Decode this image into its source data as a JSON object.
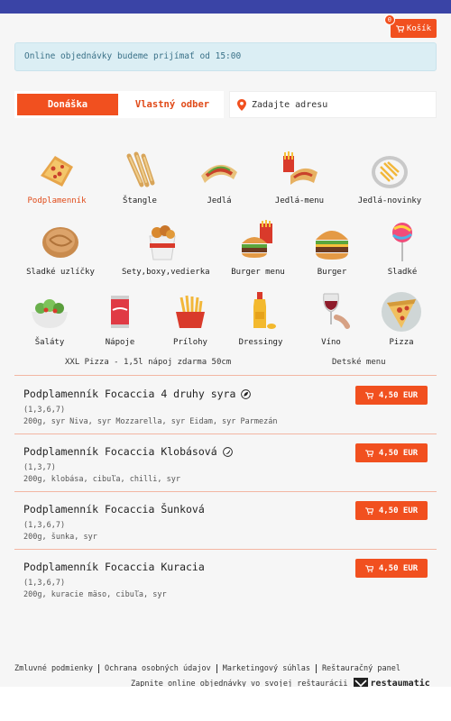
{
  "header": {
    "cart_label": "Košík",
    "cart_count": "0"
  },
  "notice": "Online objednávky budeme prijímať od 15:00",
  "modes": {
    "delivery": "Donáška",
    "pickup": "Vlastný odber"
  },
  "address": {
    "placeholder": "Zadajte adresu"
  },
  "categories": [
    {
      "label": "Podplamenník",
      "icon": "flatbread-icon",
      "active": true
    },
    {
      "label": "Štangle",
      "icon": "breadsticks-icon"
    },
    {
      "label": "Jedlá",
      "icon": "wrap-icon"
    },
    {
      "label": "Jedlá-menu",
      "icon": "meal-menu-icon"
    },
    {
      "label": "Jedlá-novinky",
      "icon": "fries-plate-icon"
    },
    {
      "label": "Sladké uzlíčky",
      "icon": "knot-pastry-icon"
    },
    {
      "label": "Sety,boxy,vedierka",
      "icon": "bucket-icon"
    },
    {
      "label": "Burger menu",
      "icon": "burger-menu-icon"
    },
    {
      "label": "Burger",
      "icon": "burger-icon"
    },
    {
      "label": "Sladké",
      "icon": "lollipop-icon"
    },
    {
      "label": "Šaláty",
      "icon": "salad-icon"
    },
    {
      "label": "Nápoje",
      "icon": "cola-can-icon"
    },
    {
      "label": "Prílohy",
      "icon": "fries-icon"
    },
    {
      "label": "Dressingy",
      "icon": "dressing-bottle-icon"
    },
    {
      "label": "Víno",
      "icon": "wine-glass-icon"
    },
    {
      "label": "Pizza",
      "icon": "pizza-slice-icon"
    }
  ],
  "subcategories": [
    "XXL Pizza - 1,5l nápoj zdarma 50cm",
    "Detské menu"
  ],
  "items": [
    {
      "name": "Podplamenník Focaccia 4 druhy syra",
      "allergens": "(1,3,6,7)",
      "desc": "200g, syr Niva, syr Mozzarella, syr Eidam, syr Parmezán",
      "price": "4,50 EUR",
      "badge": "leaf-badge-icon"
    },
    {
      "name": "Podplamenník Focaccia Klobásová",
      "allergens": "(1,3,7)",
      "desc": "200g, klobása, cibuľa, chilli, syr",
      "price": "4,50 EUR",
      "badge": "chili-badge-icon"
    },
    {
      "name": "Podplamenník Focaccia Šunková",
      "allergens": "(1,3,6,7)",
      "desc": "200g, šunka, syr",
      "price": "4,50 EUR"
    },
    {
      "name": "Podplamenník Focaccia Kuracia",
      "allergens": "(1,3,6,7)",
      "desc": "200g, kuracie mäso, cibuľa, syr",
      "price": "4,50 EUR"
    }
  ],
  "footer": {
    "links": [
      "Zmluvné podmienky",
      "Ochrana osobných údajov",
      "Marketingový súhlas",
      "Reštauračný panel"
    ],
    "promo": "Zapnite online objednávky vo svojej reštaurácii",
    "brand": "restaumatic"
  },
  "colors": {
    "accent": "#f1501f",
    "topbar": "#3a44a6",
    "notice_bg": "#dbeef4"
  }
}
